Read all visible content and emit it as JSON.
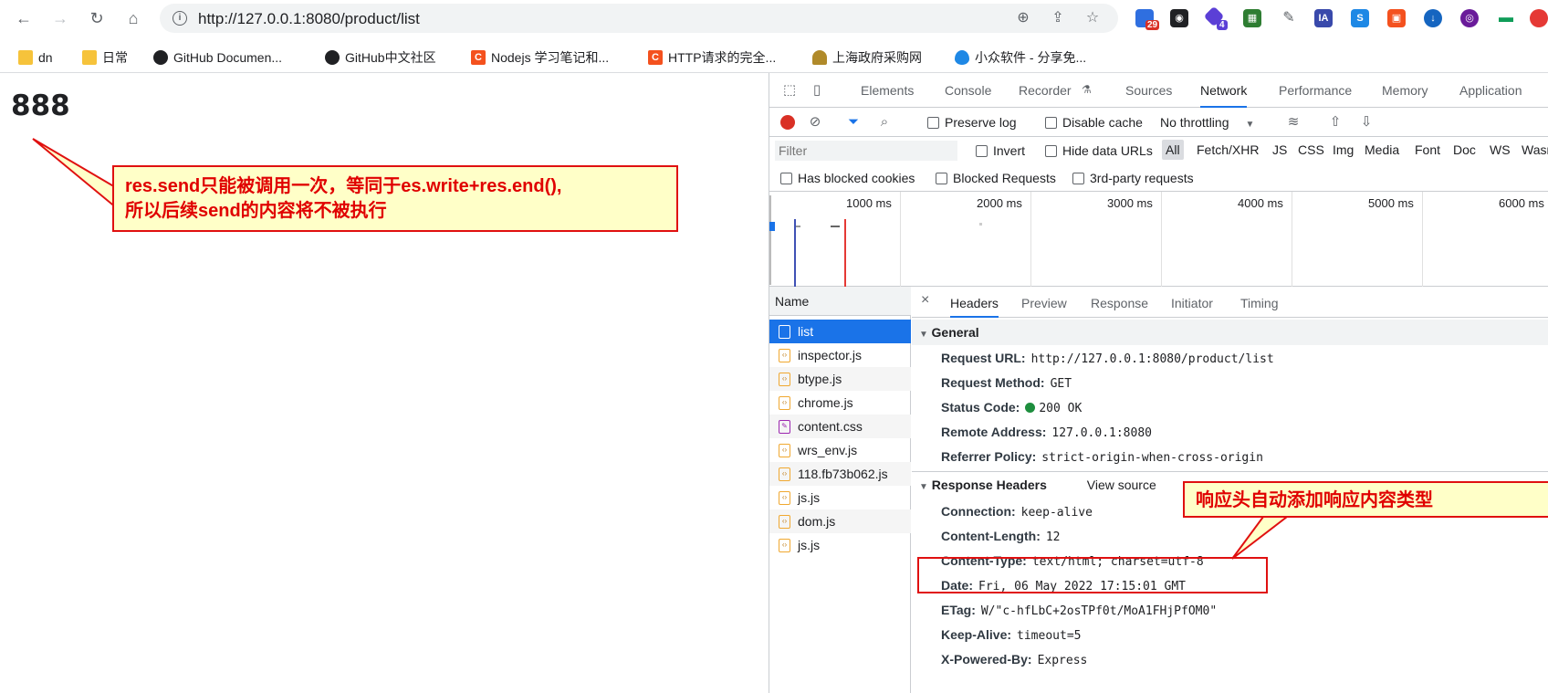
{
  "browser": {
    "url": "http://127.0.0.1:8080/product/list",
    "ext_badge_1": "29",
    "ext_badge_2": "4",
    "ext_ia": "IA"
  },
  "bookmarks": [
    {
      "label": "dn",
      "icon": "folder-icon"
    },
    {
      "label": "日常",
      "icon": "folder-icon"
    },
    {
      "label": "GitHub Documen...",
      "icon": "github-icon"
    },
    {
      "label": "GitHub中文社区",
      "icon": "github-icon"
    },
    {
      "label": "Nodejs 学习笔记和...",
      "icon": "c-logo-icon"
    },
    {
      "label": "HTTP请求的完全...",
      "icon": "c-logo-icon"
    },
    {
      "label": "上海政府采购网",
      "icon": "site-icon"
    },
    {
      "label": "小众软件 - 分享免...",
      "icon": "drop-icon"
    }
  ],
  "page": {
    "text": "888"
  },
  "annotation_main": {
    "line1": "res.send只能被调用一次，等同于es.write+res.end(),",
    "line2": "所以后续send的内容将不被执行"
  },
  "annotation_header": {
    "text": "响应头自动添加响应内容类型"
  },
  "devtools": {
    "tabs": [
      "Elements",
      "Console",
      "Recorder",
      "Sources",
      "Network",
      "Performance",
      "Memory",
      "Application"
    ],
    "active_tab": "Network",
    "toolbar": {
      "preserve_log": "Preserve log",
      "disable_cache": "Disable cache",
      "throttling": "No throttling"
    },
    "filter": {
      "placeholder": "Filter",
      "invert": "Invert",
      "hide_data_urls": "Hide data URLs",
      "types": [
        "All",
        "Fetch/XHR",
        "JS",
        "CSS",
        "Img",
        "Media",
        "Font",
        "Doc",
        "WS",
        "Wasm"
      ]
    },
    "options": {
      "blocked_cookies": "Has blocked cookies",
      "blocked_requests": "Blocked Requests",
      "third_party": "3rd-party requests"
    },
    "timeline_ticks": [
      "1000 ms",
      "2000 ms",
      "3000 ms",
      "4000 ms",
      "5000 ms",
      "6000 ms"
    ],
    "requests_header": "Name",
    "requests": [
      "list",
      "inspector.js",
      "btype.js",
      "chrome.js",
      "content.css",
      "wrs_env.js",
      "118.fb73b062.js",
      "js.js",
      "dom.js",
      "js.js"
    ],
    "detail_tabs": [
      "Headers",
      "Preview",
      "Response",
      "Initiator",
      "Timing"
    ],
    "general_title": "General",
    "general": [
      {
        "k": "Request URL:",
        "v": "http://127.0.0.1:8080/product/list"
      },
      {
        "k": "Request Method:",
        "v": "GET"
      },
      {
        "k": "Status Code:",
        "v": "200 OK"
      },
      {
        "k": "Remote Address:",
        "v": "127.0.0.1:8080"
      },
      {
        "k": "Referrer Policy:",
        "v": "strict-origin-when-cross-origin"
      }
    ],
    "response_title": "Response Headers",
    "view_source": "View source",
    "response": [
      {
        "k": "Connection:",
        "v": "keep-alive"
      },
      {
        "k": "Content-Length:",
        "v": "12"
      },
      {
        "k": "Content-Type:",
        "v": "text/html; charset=utf-8"
      },
      {
        "k": "Date:",
        "v": "Fri, 06 May 2022 17:15:01 GMT"
      },
      {
        "k": "ETag:",
        "v": "W/\"c-hfLbC+2osTPf0t/MoA1FHjPfOM0\""
      },
      {
        "k": "Keep-Alive:",
        "v": "timeout=5"
      },
      {
        "k": "X-Powered-By:",
        "v": "Express"
      }
    ]
  },
  "colors": {
    "accent": "#1a73e8",
    "selected_row": "#1a73e8",
    "record": "#d93025",
    "callout_border": "#e01010",
    "callout_text": "#e00000"
  }
}
